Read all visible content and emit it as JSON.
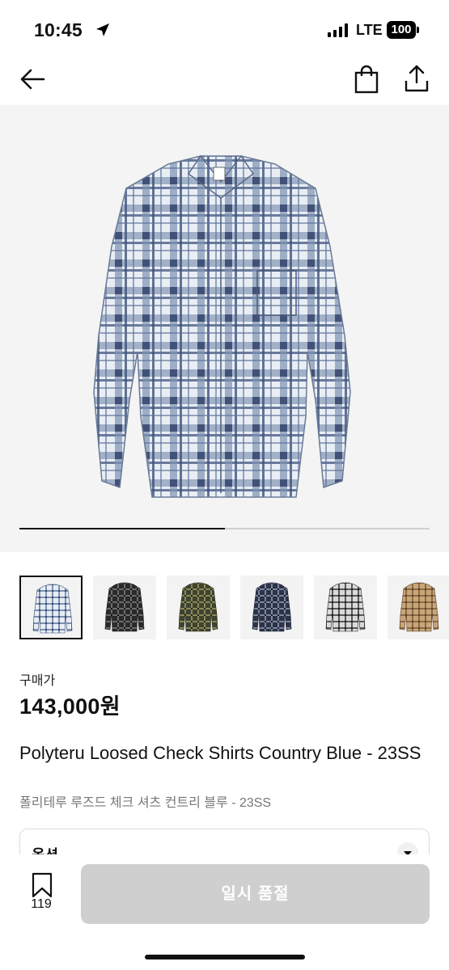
{
  "status": {
    "time": "10:45",
    "network": "LTE",
    "battery": "100"
  },
  "nav": {
    "back_icon": "arrow-left-icon",
    "bag_icon": "shopping-bag-icon",
    "share_icon": "share-icon"
  },
  "gallery": {
    "progress_fraction": 0.5,
    "thumbnails": [
      {
        "colorway": "country blue",
        "selected": true
      },
      {
        "colorway": "black",
        "selected": false
      },
      {
        "colorway": "khaki",
        "selected": false
      },
      {
        "colorway": "navy",
        "selected": false
      },
      {
        "colorway": "grey",
        "selected": false
      },
      {
        "colorway": "beige",
        "selected": false
      }
    ]
  },
  "product": {
    "price_label": "구매가",
    "price": "143,000원",
    "title_en": "Polyteru Loosed Check Shirts Country Blue - 23SS",
    "title_ko": "폴리테루 루즈드 체크 셔츠 컨트리 블루 - 23SS"
  },
  "option": {
    "label": "옵션"
  },
  "bottom": {
    "wish_count": "119",
    "buy_label": "일시 품절"
  },
  "colors": {
    "sold_out_button": "#cfcfcf",
    "hero_bg": "#f4f4f4",
    "text": "#111111"
  }
}
